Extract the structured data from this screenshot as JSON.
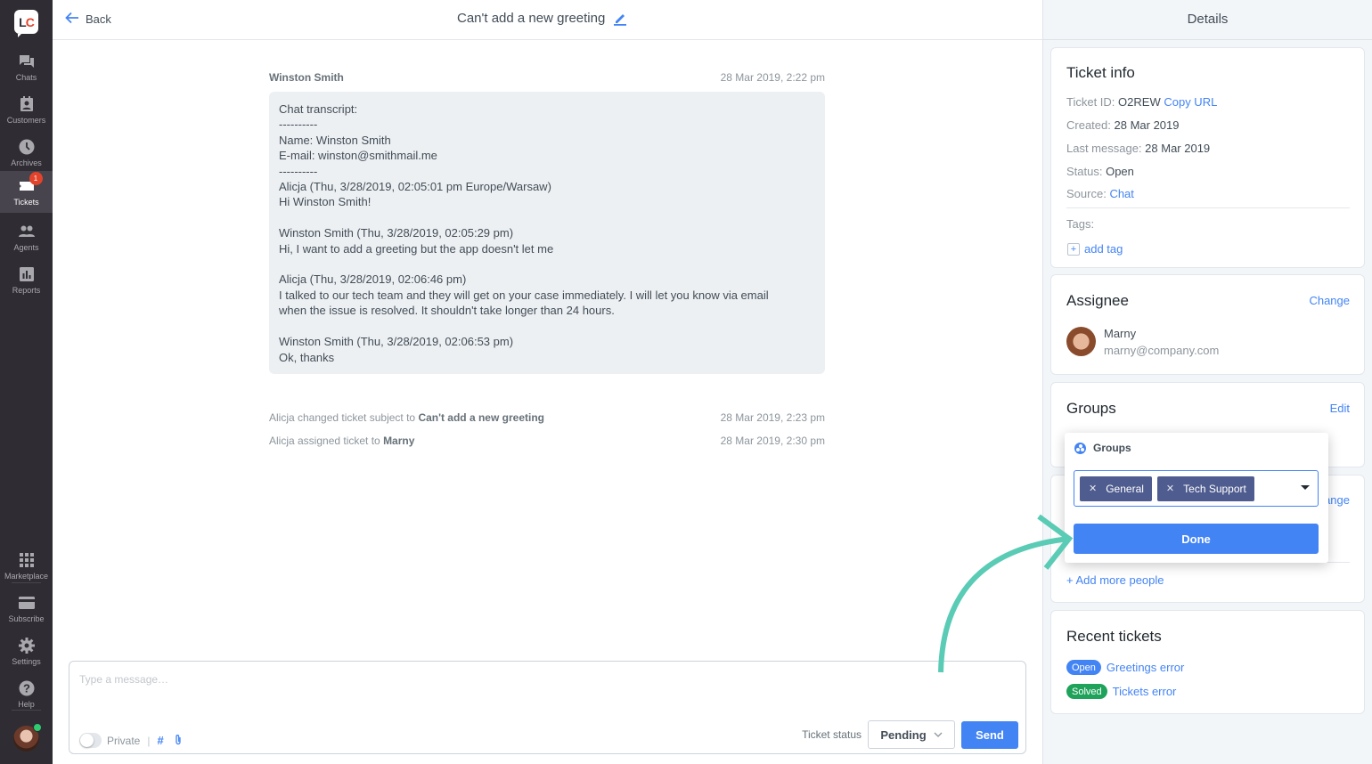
{
  "sidebar": {
    "logo": {
      "l": "L",
      "c": "C"
    },
    "items": [
      {
        "label": "Chats",
        "icon": "chats-icon"
      },
      {
        "label": "Customers",
        "icon": "customers-icon"
      },
      {
        "label": "Archives",
        "icon": "archives-icon"
      },
      {
        "label": "Tickets",
        "icon": "tickets-icon",
        "badge": "1",
        "active": true
      },
      {
        "label": "Agents",
        "icon": "agents-icon"
      },
      {
        "label": "Reports",
        "icon": "reports-icon"
      }
    ],
    "bottom_items": [
      {
        "label": "Marketplace",
        "icon": "marketplace-icon"
      },
      {
        "label": "Subscribe",
        "icon": "subscribe-icon"
      },
      {
        "label": "Settings",
        "icon": "settings-icon"
      },
      {
        "label": "Help",
        "icon": "help-icon"
      }
    ]
  },
  "topbar": {
    "back_label": "Back",
    "subject": "Can't add a new greeting"
  },
  "thread": {
    "message": {
      "author": "Winston Smith",
      "time": "28 Mar 2019, 2:22 pm",
      "body": "Chat transcript:\n----------\nName: Winston Smith\nE-mail: winston@smithmail.me\n----------\nAlicja (Thu, 3/28/2019, 02:05:01 pm Europe/Warsaw)\nHi Winston Smith!\n\nWinston Smith (Thu, 3/28/2019, 02:05:29 pm)\nHi, I want to add a greeting but the app doesn't let me\n\nAlicja (Thu, 3/28/2019, 02:06:46 pm)\nI talked to our tech team and they will get on your case immediately. I will let you know via email\nwhen the issue is resolved. It shouldn't take longer than 24 hours.\n\nWinston Smith (Thu, 3/28/2019, 02:06:53 pm)\nOk, thanks"
    },
    "events": [
      {
        "text": "Alicja changed ticket subject to ",
        "bold": "Can't add a new greeting",
        "time": "28 Mar 2019, 2:23 pm"
      },
      {
        "text": "Alicja assigned ticket to ",
        "bold": "Marny",
        "time": "28 Mar 2019, 2:30 pm"
      }
    ]
  },
  "composer": {
    "placeholder": "Type a message…",
    "private_label": "Private",
    "pipe": "|",
    "hash": "#",
    "ticket_status_label": "Ticket status",
    "ticket_status_value": "Pending",
    "send_label": "Send"
  },
  "details": {
    "title": "Details",
    "ticket_info": {
      "title": "Ticket info",
      "ticket_id_label": "Ticket ID:",
      "ticket_id": "O2REW",
      "copy_url": "Copy URL",
      "created_label": "Created:",
      "created": "28 Mar 2019",
      "last_message_label": "Last message:",
      "last_message": "28 Mar 2019",
      "status_label": "Status:",
      "status": "Open",
      "source_label": "Source:",
      "source": "Chat",
      "tags_label": "Tags:",
      "add_tag": "add tag"
    },
    "assignee": {
      "title": "Assignee",
      "change": "Change",
      "name": "Marny",
      "email": "marny@company.com"
    },
    "groups": {
      "title": "Groups",
      "edit": "Edit"
    },
    "participants": {
      "change": "Change",
      "add_more": "+ Add more people"
    },
    "recent_tickets": {
      "title": "Recent tickets",
      "items": [
        {
          "status": "Open",
          "status_color": "#4384f5",
          "title": "Greetings error"
        },
        {
          "status": "Solved",
          "status_color": "#1fa35b",
          "title": "Tickets error"
        }
      ]
    }
  },
  "groups_popover": {
    "title": "Groups",
    "selected": [
      "General",
      "Tech Support"
    ],
    "done_label": "Done"
  },
  "colors": {
    "accent": "#4384f5",
    "sidebar_bg": "#2f2d33",
    "badge": "#e3432b",
    "chip": "#4f5c8f",
    "annotation_arrow": "#5acbb5"
  }
}
